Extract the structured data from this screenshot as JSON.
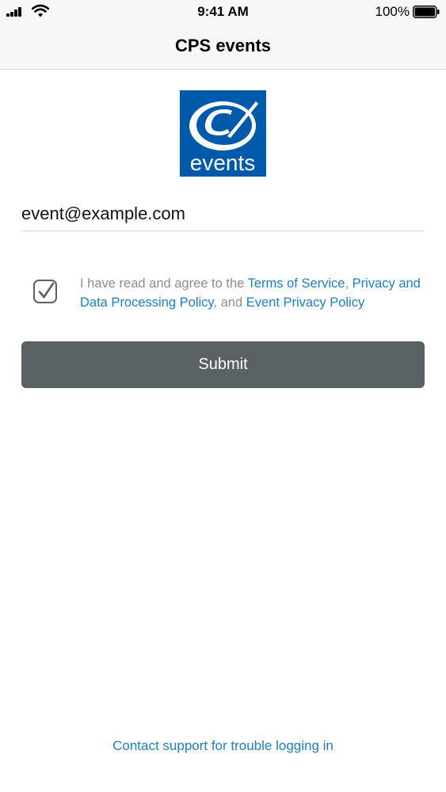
{
  "status_bar": {
    "time": "9:41 AM",
    "battery_percent": "100%",
    "signal_icon": "cellular-signal-icon",
    "wifi_icon": "wifi-icon",
    "battery_icon": "battery-icon"
  },
  "nav": {
    "title": "CPS events"
  },
  "logo": {
    "icon": "cps-events-logo",
    "text": "events",
    "background": "#005aab"
  },
  "form": {
    "email_value": "event@example.com",
    "agree_checked": true,
    "terms": {
      "prefix": "I have read and agree to the ",
      "terms_link": "Terms of Service",
      "sep1": ", ",
      "privacy_link": "Privacy and Data Processing Policy",
      "sep2": ", and ",
      "event_privacy_link": "Event Privacy Policy"
    },
    "submit_label": "Submit"
  },
  "footer": {
    "support_link": "Contact support for trouble logging in"
  },
  "colors": {
    "link": "#1a7fc4",
    "button": "#5a6165",
    "bar": "#f7f7f7"
  }
}
